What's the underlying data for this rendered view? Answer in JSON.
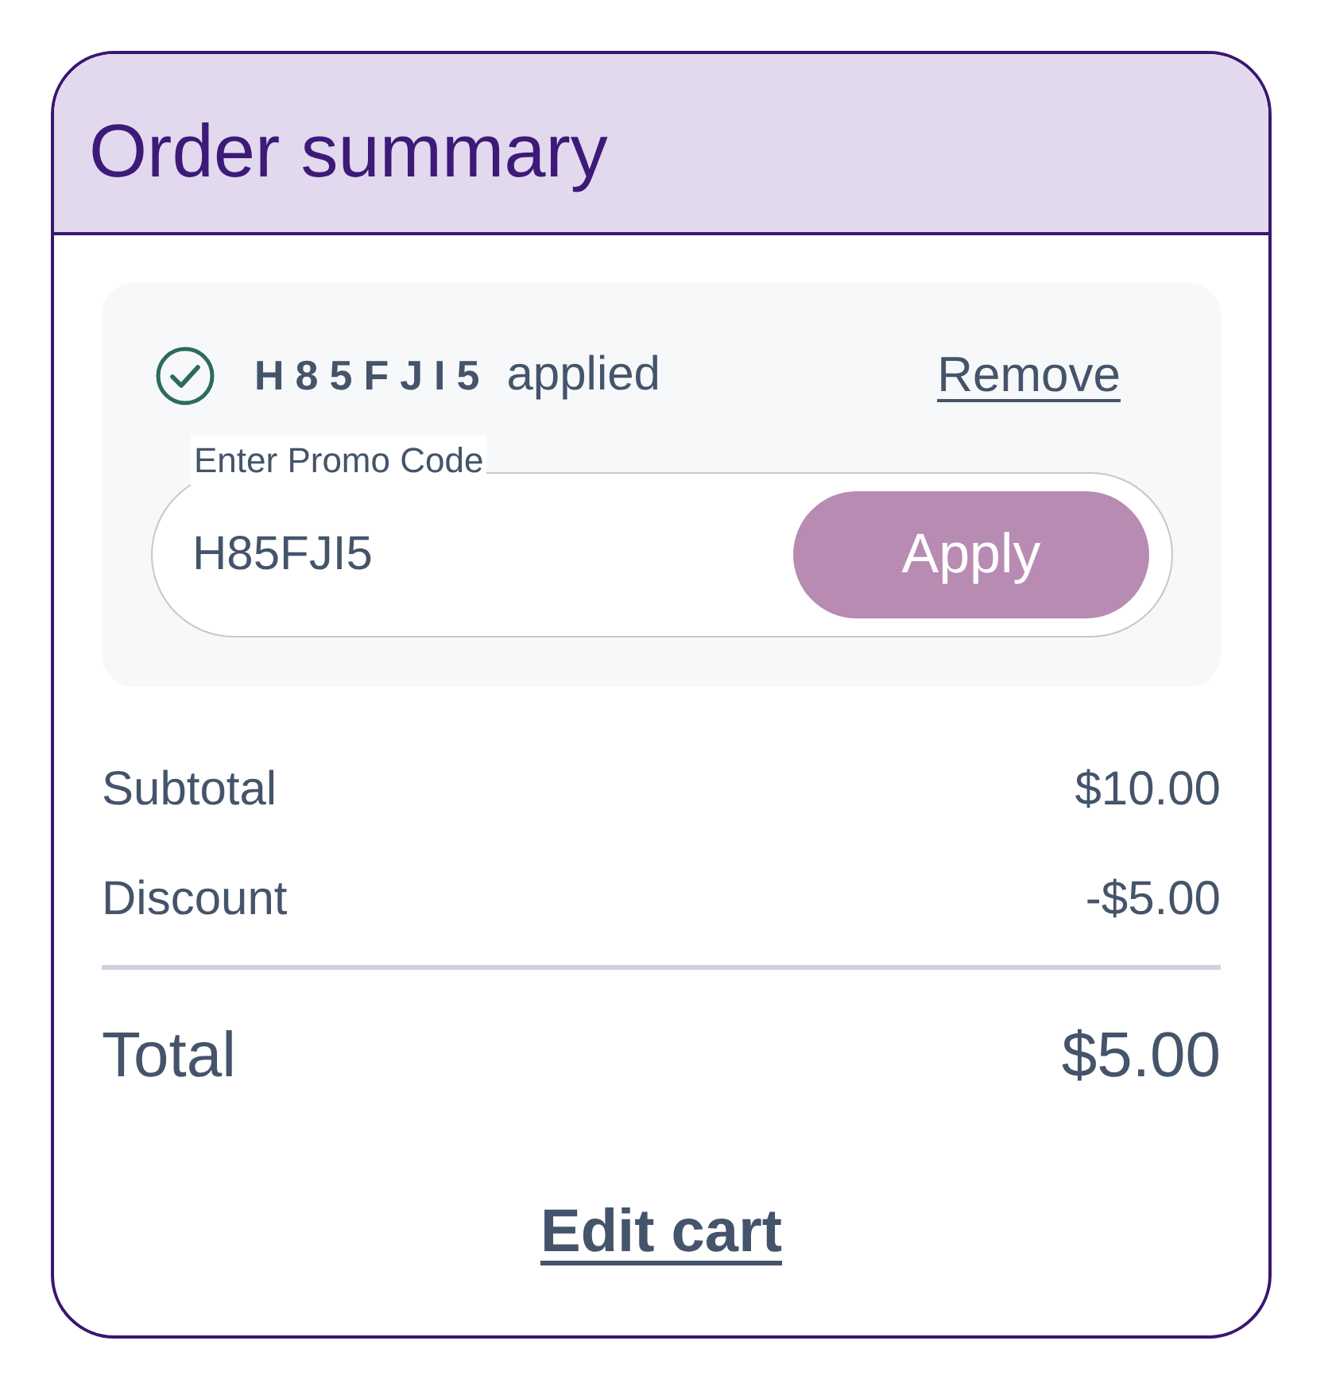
{
  "header": {
    "title": "Order summary"
  },
  "promo": {
    "applied": {
      "code": "H85FJI5",
      "status": "applied",
      "remove_link": "Remove"
    },
    "field": {
      "label": "Enter Promo Code",
      "value": "H85FJI5"
    },
    "apply_button": "Apply"
  },
  "summary_lines": [
    {
      "label": "Subtotal",
      "amount": "$10.00"
    },
    {
      "label": "Discount",
      "amount": "-$5.00"
    }
  ],
  "total": {
    "label": "Total",
    "amount": "$5.00"
  },
  "edit_cart_link": "Edit cart"
}
